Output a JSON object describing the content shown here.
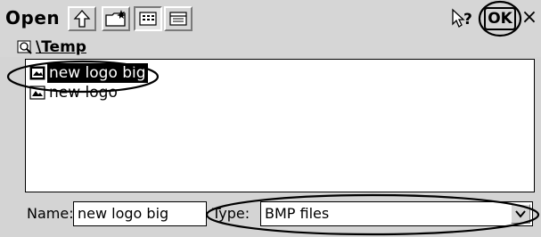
{
  "dialog": {
    "title": "Open",
    "toolbar": {
      "up_icon": "folder-up-icon",
      "new_folder_icon": "new-folder-icon",
      "list_view_icon": "list-view-icon",
      "details_view_icon": "details-view-icon",
      "active_view": "list"
    },
    "help_icon": "help-arrow-icon",
    "ok_label": "OK",
    "close_label": "×"
  },
  "path": {
    "icon": "folder-search-icon",
    "text": "\\Temp"
  },
  "files": [
    {
      "name": "new logo big",
      "icon": "bitmap-file-icon",
      "selected": true
    },
    {
      "name": "new logo",
      "icon": "bitmap-file-icon",
      "selected": false
    }
  ],
  "form": {
    "name_label": "Name:",
    "name_value": "new logo big",
    "type_label": "Type:",
    "type_value": "BMP files"
  }
}
